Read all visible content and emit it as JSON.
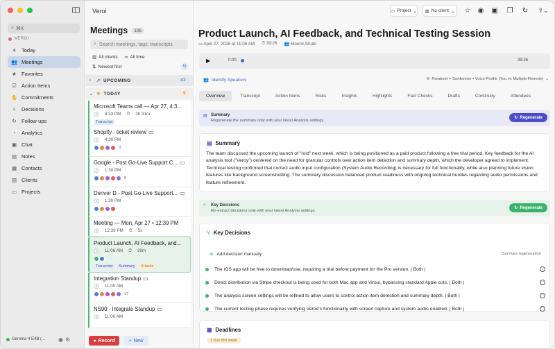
{
  "colors": {
    "accent": "#3a6bc9",
    "green": "#3bb26a",
    "record": "#d93d3d",
    "regen": "#4a4fc9"
  },
  "sidebar": {
    "search_hint": "⌘K",
    "workspace": "VEROI",
    "items": [
      {
        "label": "Today",
        "icon": "sun-icon"
      },
      {
        "label": "Meetings",
        "icon": "people-icon"
      },
      {
        "label": "Favorites",
        "icon": "star-icon"
      },
      {
        "label": "Action Items",
        "icon": "check-icon"
      },
      {
        "label": "Commitments",
        "icon": "handshake-icon"
      },
      {
        "label": "Decisions",
        "icon": "fork-icon"
      },
      {
        "label": "Follow-ups",
        "icon": "followup-icon"
      },
      {
        "label": "Analytics",
        "icon": "chart-icon"
      },
      {
        "label": "Chat",
        "icon": "chat-icon"
      },
      {
        "label": "Notes",
        "icon": "note-icon"
      },
      {
        "label": "Contacts",
        "icon": "contact-icon"
      },
      {
        "label": "Clients",
        "icon": "client-icon"
      },
      {
        "label": "Projects",
        "icon": "folder-icon"
      }
    ],
    "model": "Gemma 4 E4B (..."
  },
  "meetings": {
    "app_title": "Veroi",
    "title": "Meetings",
    "count": "106",
    "search_placeholder": "Search meetings, tags, transcripts",
    "filter_clients": "All clients",
    "filter_time": "All time",
    "sort": "Newest first",
    "upcoming_label": "UPCOMING",
    "upcoming_count": "42",
    "today_label": "TODAY",
    "today_count": "9",
    "list": [
      {
        "title": "Microsoft Teams call — Apr 27, 4:3...",
        "time": "4:33 PM",
        "duration": "2h 31m",
        "tags": [
          "Transcript"
        ]
      },
      {
        "title": "Shopify - ticket review",
        "time": "4:30 PM",
        "more": "3"
      },
      {
        "title": "Google - Post Go-Live Support C...",
        "time": "1:30 PM",
        "more": "8"
      },
      {
        "title": "Denver D - Post Go-Live Support...",
        "time": "1:30 PM"
      },
      {
        "title": "Meeting — Mon, Apr 27 • 12:39 PM",
        "time": "12:39 PM",
        "duration": "5s"
      },
      {
        "title": "Product Launch, AI Feedback, and...",
        "time": "11:06 AM",
        "duration": "39m",
        "tags": [
          "Transcript",
          "Summary",
          "8 tasks"
        ]
      },
      {
        "title": "Integration Standup",
        "time": "11:00 AM",
        "more": "17"
      },
      {
        "title": "NS90 - Integrate Standup",
        "time": "11:00 AM"
      }
    ],
    "record_label": "Record",
    "new_label": "New"
  },
  "toolbar": {
    "project": "Project",
    "client": "No client"
  },
  "main": {
    "title": "Product Launch, AI Feedback, and Technical Testing Session",
    "date": "April 27, 2026 at 11:06 AM",
    "duration": "39:26",
    "people": "Mounir,Shubi",
    "player_start": "0:00",
    "player_end": "39:26",
    "identify_speakers": "Identify Speakers",
    "model_info": "Parakeet + Sortformer • Voice Profile (You vs Multiple Remote)",
    "tabs": [
      "Overview",
      "Transcript",
      "Action Items",
      "Risks",
      "Insights",
      "Highlights",
      "Fact Checks",
      "Drafts",
      "Continuity",
      "Attendees"
    ],
    "summary_banner": {
      "title": "Summary",
      "subtitle": "Regenerate the summary only with your latest Analysis settings.",
      "button": "Regenerate"
    },
    "summary": {
      "heading": "Summary",
      "text": "The team discussed the upcoming launch of \"roid\" next week, which is being positioned as a paid product following a free trial period. Key feedback for the AI analysis tool (\"Veroy\") centered on the need for granular controls over action item detection and summary depth, which the developer agreed to implement. Technical testing confirmed that correct audio input configuration (System Audio Recording) is necessary for full functionality, while also planning future vision features like background screenshotting. The summary discussion balanced product readiness with ongoing technical hurdles regarding audio permissions and feature refinement."
    },
    "decisions_banner": {
      "title": "Key Decisions",
      "subtitle": "Re-extract decisions only with your latest Analysis settings.",
      "button": "Regenerate"
    },
    "decisions": {
      "heading": "Key Decisions",
      "add_label": "Add decision manually",
      "survives": "Survives regeneration",
      "items": [
        "The iOS app will be free to download/use, requiring a trial before payment for the Pro version. | Both |",
        "Direct distribution via Stripe checkout is being used for both Mac app and Viroui, bypassing standard Apple cuts. | Both |",
        "The analysis screen settings will be refined to allow users to control action item detection and summary depth. | Both |",
        "The current testing phase requires verifying Veroe's functionality with screen capture and system audio enabled. | Both |"
      ]
    },
    "deadlines": {
      "heading": "Deadlines",
      "due": "1 due this week"
    }
  }
}
